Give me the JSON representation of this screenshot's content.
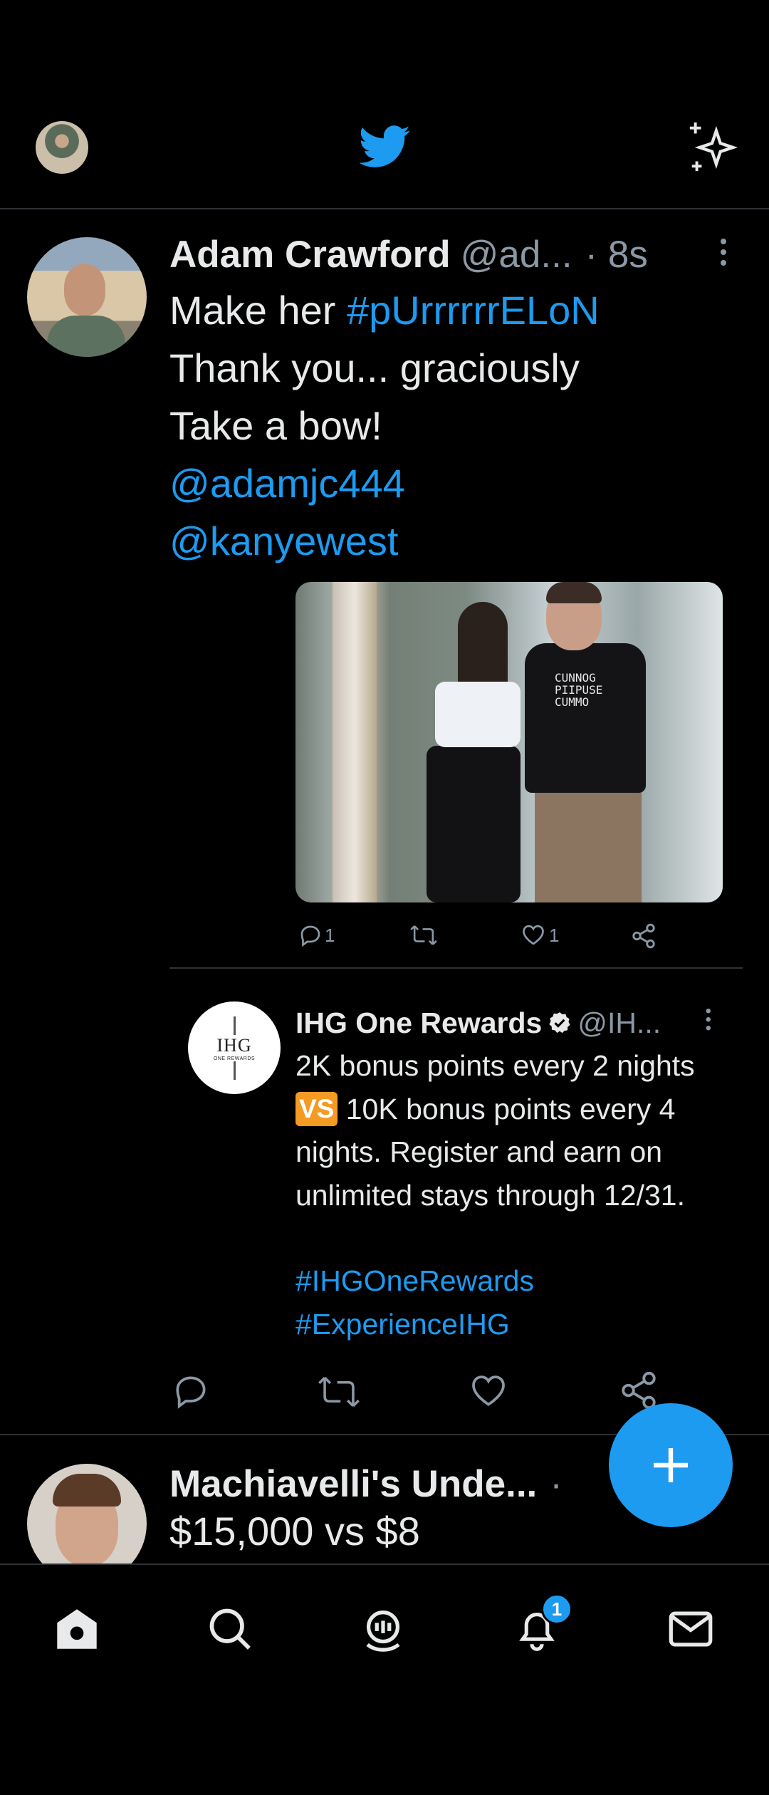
{
  "topbar": {
    "profile_avatar": "user-avatar",
    "logo_icon": "twitter-bird-icon",
    "sparkle_icon": "sparkle-icon"
  },
  "tweets": [
    {
      "name": "Adam Crawford",
      "handle": "@ad...",
      "time": "· 8s",
      "lines": [
        {
          "text": "Make her ",
          "link": "#pUrrrrrrELoN"
        },
        {
          "text": "Thank you... graciously"
        },
        {
          "text": "Take a bow!"
        },
        {
          "link": "@adamjc444"
        },
        {
          "link": "@kanyewest"
        }
      ],
      "media_shirt_text": "CUNNOG\nPIIPUSE\nCUMMO",
      "actions": {
        "reply_count": "1",
        "retweet_count": "",
        "like_count": "1"
      }
    },
    {
      "name": "Machiavelli's Unde...",
      "time": "·",
      "text": "$15,000 vs $8"
    }
  ],
  "quote": {
    "name": "IHG One Rewards",
    "handle": "@IH...",
    "avatar_text": "IHG",
    "avatar_sub": "ONE REWARDS",
    "text_before_vs": "2K bonus points every 2 nights ",
    "vs": "VS",
    "text_after_vs": " 10K bonus points every 4 nights. Register and earn on unlimited stays through 12/31.",
    "hashtag1": "#IHGOneRewards",
    "hashtag2": "#ExperienceIHG"
  },
  "notifications_badge": "1",
  "colors": {
    "accent": "#1d9bf0",
    "background": "#000000",
    "muted": "#8b98a5",
    "divider": "#2f3336"
  }
}
